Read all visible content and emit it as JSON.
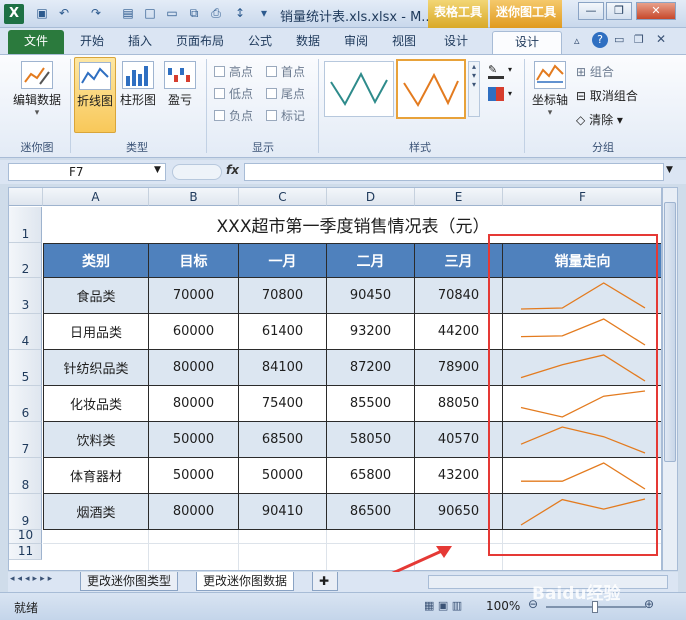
{
  "window": {
    "title": "销量统计表.xls.xlsx - M...",
    "context_tabs": {
      "table_tools": "表格工具",
      "sparkline_tools": "迷你图工具"
    }
  },
  "ribbon_tabs": [
    "文件",
    "开始",
    "插入",
    "页面布局",
    "公式",
    "数据",
    "审阅",
    "视图",
    "设计",
    "设计"
  ],
  "ribbon": {
    "groups": {
      "sparkline": "迷你图",
      "type": "类型",
      "show": "显示",
      "style": "样式",
      "group": "分组"
    },
    "edit_data": "编辑数据",
    "types": [
      "折线图",
      "柱形图",
      "盈亏"
    ],
    "show_options": [
      "高点",
      "首点",
      "低点",
      "尾点",
      "负点",
      "标记"
    ],
    "axis": "坐标轴",
    "group_btn": "组合",
    "ungroup_btn": "取消组合",
    "clear_btn": "清除"
  },
  "formula_bar": {
    "cell_ref": "F7",
    "fx": "fx",
    "formula": ""
  },
  "sheet": {
    "columns": [
      "A",
      "B",
      "C",
      "D",
      "E",
      "F"
    ],
    "rows": [
      "1",
      "2",
      "3",
      "4",
      "5",
      "6",
      "7",
      "8",
      "9",
      "10",
      "11"
    ],
    "title": "XXX超市第一季度销售情况表（元）",
    "headers": [
      "类别",
      "目标",
      "一月",
      "二月",
      "三月",
      "销量走向"
    ],
    "data": [
      {
        "category": "食品类",
        "target": "70000",
        "jan": "70800",
        "feb": "90450",
        "mar": "70840",
        "trend": [
          70000,
          70800,
          90450,
          70840
        ]
      },
      {
        "category": "日用品类",
        "target": "60000",
        "jan": "61400",
        "feb": "93200",
        "mar": "44200",
        "trend": [
          60000,
          61400,
          93200,
          44200
        ]
      },
      {
        "category": "针纺织品类",
        "target": "80000",
        "jan": "84100",
        "feb": "87200",
        "mar": "78900",
        "trend": [
          80000,
          84100,
          87200,
          78900
        ]
      },
      {
        "category": "化妆品类",
        "target": "80000",
        "jan": "75400",
        "feb": "85500",
        "mar": "88050",
        "trend": [
          80000,
          75400,
          85500,
          88050
        ]
      },
      {
        "category": "饮料类",
        "target": "50000",
        "jan": "68500",
        "feb": "58050",
        "mar": "40570",
        "trend": [
          50000,
          68500,
          58050,
          40570
        ]
      },
      {
        "category": "体育器材",
        "target": "50000",
        "jan": "50000",
        "feb": "65800",
        "mar": "43200",
        "trend": [
          50000,
          50000,
          65800,
          43200
        ]
      },
      {
        "category": "烟酒类",
        "target": "80000",
        "jan": "90410",
        "feb": "86500",
        "mar": "90650",
        "trend": [
          80000,
          90410,
          86500,
          90650
        ]
      }
    ],
    "sparkline_color": "#e37b1f"
  },
  "sheet_tabs": [
    "更改迷你图类型",
    "更改迷你图数据"
  ],
  "status": {
    "ready": "就绪",
    "zoom": "100%"
  },
  "watermark": "Baidu经验"
}
